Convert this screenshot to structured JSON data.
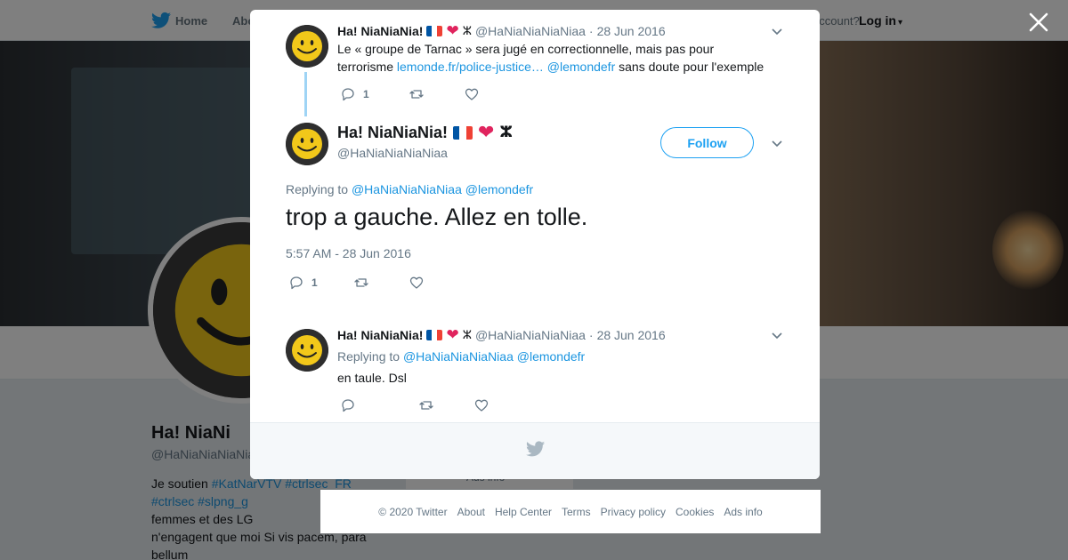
{
  "nav": {
    "home_label": "Home",
    "about_label": "Abo",
    "account_prompt": "account?",
    "login_label": "Log in"
  },
  "profile": {
    "name": "Ha! NiaNi",
    "handle": "@HaNiaNiaNiaNiaa",
    "bio_prefix": "Je soutien",
    "bio_tag1": "#KatNarVTV",
    "bio_tag2": "#ctrlsec_FR",
    "bio_tag3": "#ctrlsec",
    "bio_tag4": "#slpng_g",
    "bio_line3": "femmes et des LG",
    "bio_line4": "n'engagent que moi Si vis pacem, para",
    "bio_line5": "bellum",
    "ads_info": "Ads info"
  },
  "tweets": [
    {
      "name": "Ha! NiaNiaNia!",
      "handle": "@HaNiaNiaNiaNiaa",
      "separator": "·",
      "date": "28 Jun 2016",
      "text_line1": "Le « groupe de Tarnac » sera jugé en correctionnelle, mais pas pour",
      "text_line2_start": "terrorisme",
      "text_link": "lemonde.fr/police-justice…",
      "text_mention": "@lemondefr",
      "text_end": "sans doute pour l'exemple",
      "reply_count": "1"
    },
    {
      "name": "Ha! NiaNiaNia!",
      "handle": "@HaNiaNiaNiaNiaa",
      "separator": "·",
      "date": "28 Jun 2016",
      "replying_label": "Replying to",
      "replying_to_1": "@HaNiaNiaNiaNiaa",
      "replying_to_2": "@lemondefr",
      "text": "en taule. Dsl",
      "reply_count": ""
    }
  ],
  "focus_tweet": {
    "name": "Ha! NiaNiaNia!",
    "handle": "@HaNiaNiaNiaNiaa",
    "follow_label": "Follow",
    "replying_label": "Replying to",
    "replying_to_1": "@HaNiaNiaNiaNiaa",
    "replying_to_2": "@lemondefr",
    "text": "trop a gauche. Allez en tolle.",
    "timestamp": "5:57 AM - 28 Jun 2016",
    "reply_count": "1"
  },
  "flag_colors": [
    "#0055a4",
    "#ffffff",
    "#ef4135"
  ],
  "yaz_glyph": "ⵣ",
  "icons": [
    "twitter-bird-icon",
    "close-icon",
    "chevron-down-icon",
    "reply-icon",
    "retweet-icon",
    "like-icon",
    "heart-emoji-icon",
    "french-flag-icon"
  ],
  "footer": {
    "copyright": "© 2020 Twitter",
    "about": "About",
    "help": "Help Center",
    "terms": "Terms",
    "privacy": "Privacy policy",
    "cookies": "Cookies",
    "ads": "Ads info"
  }
}
